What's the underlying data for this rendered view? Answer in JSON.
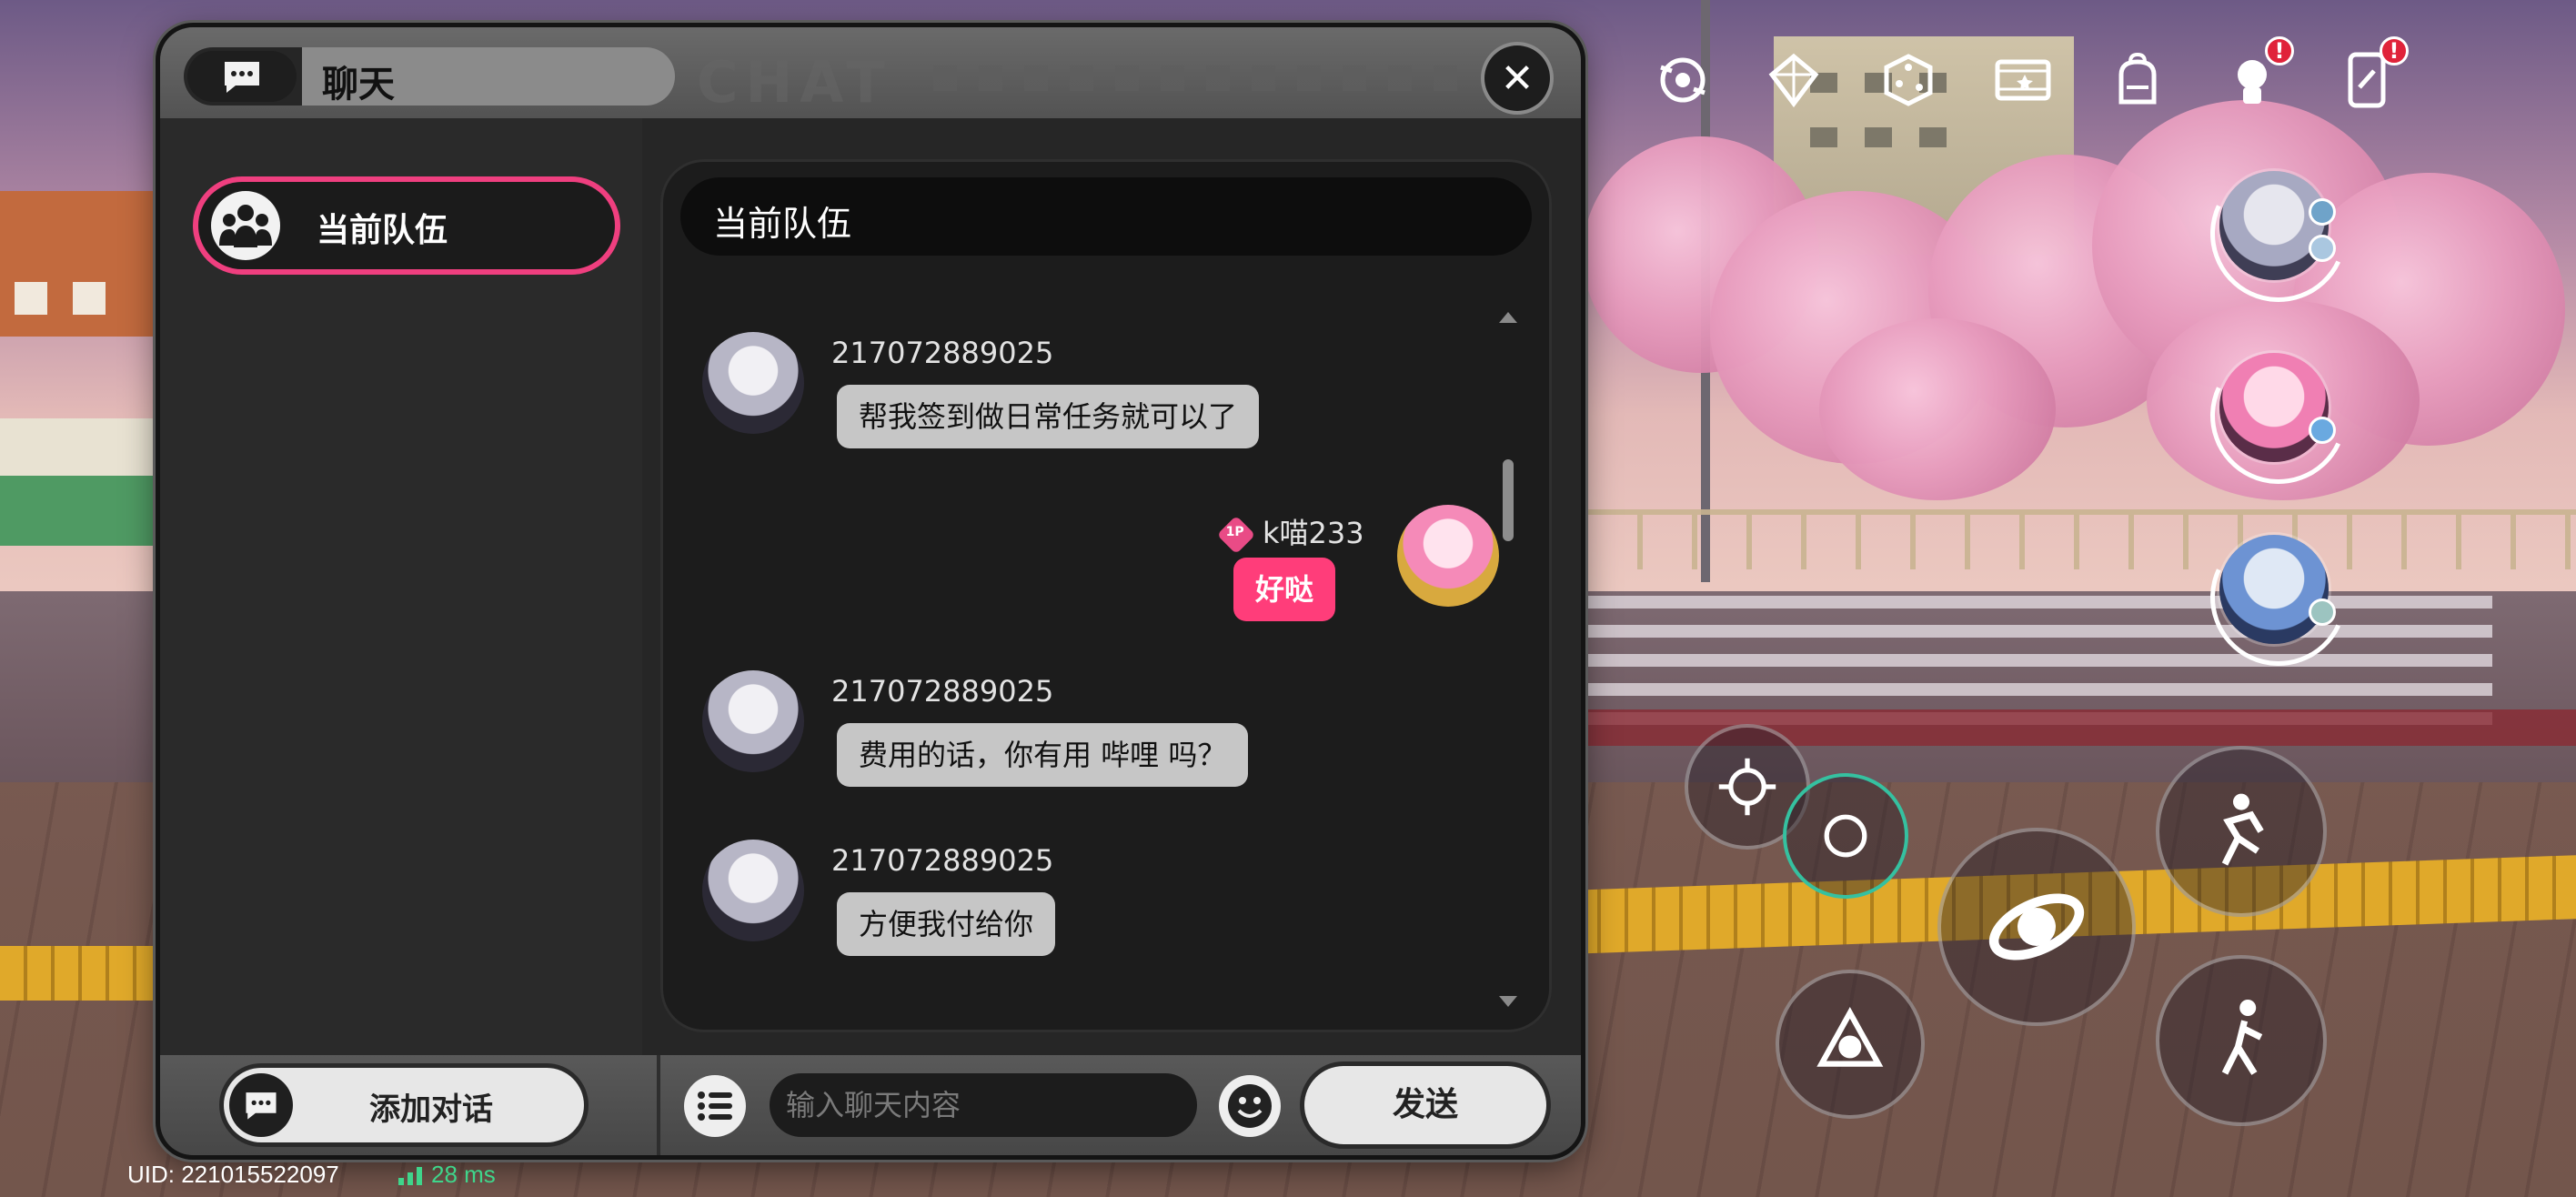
{
  "chat": {
    "title": "聊天",
    "watermark": "CHAT",
    "close_label": "✕",
    "sidebar": {
      "team_tab_label": "当前队伍"
    },
    "panel_header": "当前队伍",
    "messages": [
      {
        "sender": "217072889025",
        "text": "帮我签到做日常任务就可以了",
        "self": false
      },
      {
        "sender": "k喵233",
        "badge": "1P",
        "text": "好哒",
        "self": true
      },
      {
        "sender": "217072889025",
        "text": "费用的话，你有用 哔哩 吗？",
        "self": false
      },
      {
        "sender": "217072889025",
        "text": "方便我付给你",
        "self": false
      }
    ],
    "footer": {
      "add_dialog_label": "添加对话",
      "input_placeholder": "输入聊天内容",
      "input_value": "",
      "send_label": "发送"
    }
  },
  "status": {
    "uid": "UID: 221015522097",
    "ping": "28 ms"
  },
  "hud": {
    "icons": [
      "target-icon",
      "crystal-icon",
      "dice-icon",
      "film-icon",
      "backpack-icon",
      "bell-icon",
      "phone-icon"
    ],
    "notification_badges": [
      "!",
      "!"
    ]
  },
  "colors": {
    "accent": "#ff3d7a",
    "panel": "#1c1c1c",
    "ping": "#3fd58b"
  }
}
